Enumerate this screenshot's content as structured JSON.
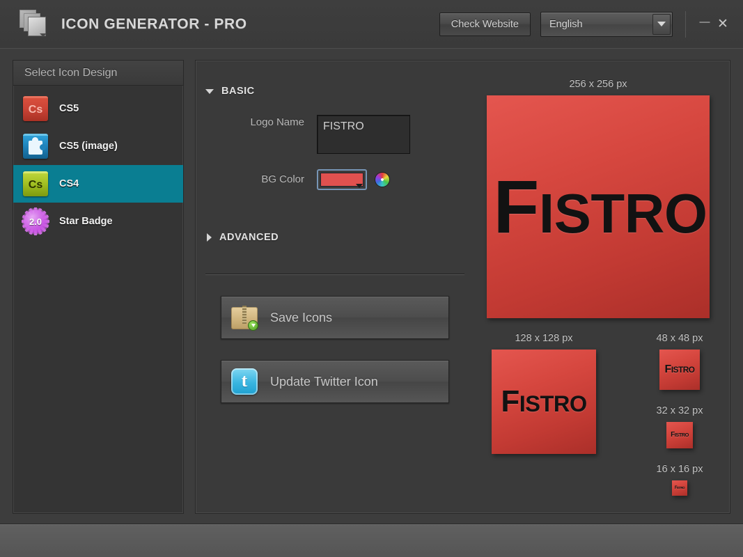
{
  "window": {
    "title": "ICON GENERATOR - PRO",
    "app_icon": "stacked-squares-icon",
    "check_website_label": "Check Website",
    "language_value": "English",
    "minimize_glyph": "—",
    "close_glyph": "✕"
  },
  "sidebar": {
    "header": "Select Icon Design",
    "items": [
      {
        "label": "CS5",
        "icon": "cs5-icon",
        "selected": false,
        "badge_text": "Cs"
      },
      {
        "label": "CS5 (image)",
        "icon": "puzzle-icon",
        "selected": false,
        "badge_text": ""
      },
      {
        "label": "CS4",
        "icon": "cs4-icon",
        "selected": true,
        "badge_text": "Cs"
      },
      {
        "label": "Star Badge",
        "icon": "star-badge-icon",
        "selected": false,
        "badge_text": "2.0"
      }
    ]
  },
  "form": {
    "basic_section": "BASIC",
    "advanced_section": "ADVANCED",
    "logo_name_label": "Logo Name",
    "logo_name_value": "FISTRO",
    "bg_color_label": "BG Color",
    "bg_color_value": "#e0514f",
    "color_wheel_icon": "color-wheel-icon",
    "save_icons_label": "Save Icons",
    "save_icons_icon": "zip-archive-download-icon",
    "update_twitter_label": "Update Twitter Icon",
    "update_twitter_icon": "twitter-bird-icon"
  },
  "preview": {
    "logo_first": "F",
    "logo_rest": "ISTRO",
    "sizes": {
      "s256": "256 x 256 px",
      "s128": "128 x 128 px",
      "s48": "48 x 48 px",
      "s32": "32 x 32 px",
      "s16": "16 x 16 px"
    }
  },
  "colors": {
    "selection": "#0a7e92",
    "icon_red": "#d6473f",
    "panel_bg": "#3a3a3a",
    "window_bg": "#3d3d3d"
  }
}
